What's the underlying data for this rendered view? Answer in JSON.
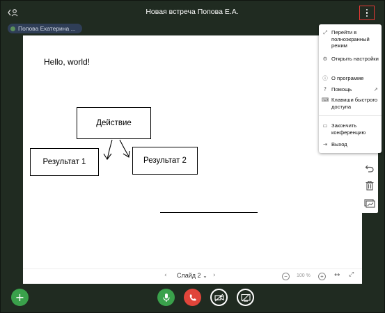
{
  "header": {
    "title": "Новая встреча Попова Е.А.",
    "back_icon": "back-user-icon",
    "more_icon": "more-vertical-icon",
    "accent_color": "#e53935"
  },
  "presenter": {
    "name": "Попова Екатерина ..."
  },
  "slide": {
    "text": "Hello, world!",
    "boxes": {
      "action": "Действие",
      "result1": "Результат 1",
      "result2": "Результат 2"
    }
  },
  "slide_toolbar": {
    "slide_label": "Слайд 2",
    "zoom": "100 %",
    "prev_icon": "chevron-left-icon",
    "next_icon": "chevron-right-icon"
  },
  "menu": {
    "items": [
      {
        "label": "Перейти в полноэкранный режим",
        "icon": "fullscreen-icon"
      },
      {
        "label": "Открыть настройки",
        "icon": "gear-icon"
      },
      {
        "label": "О программе",
        "icon": "info-icon"
      },
      {
        "label": "Помощь",
        "icon": "help-icon",
        "ext_icon": "external-link-icon"
      },
      {
        "label": "Клавиши быстрого доступа",
        "icon": "keyboard-icon"
      },
      {
        "label": "Закончить конференцию",
        "icon": "end-conference-icon"
      },
      {
        "label": "Выход",
        "icon": "logout-icon"
      }
    ]
  },
  "callbar": {
    "add": "+",
    "mic_color": "#3aa14b",
    "hangup_color": "#e0453a"
  },
  "colors": {
    "background": "#202b21",
    "presenter_chip": "#2f3e57"
  }
}
